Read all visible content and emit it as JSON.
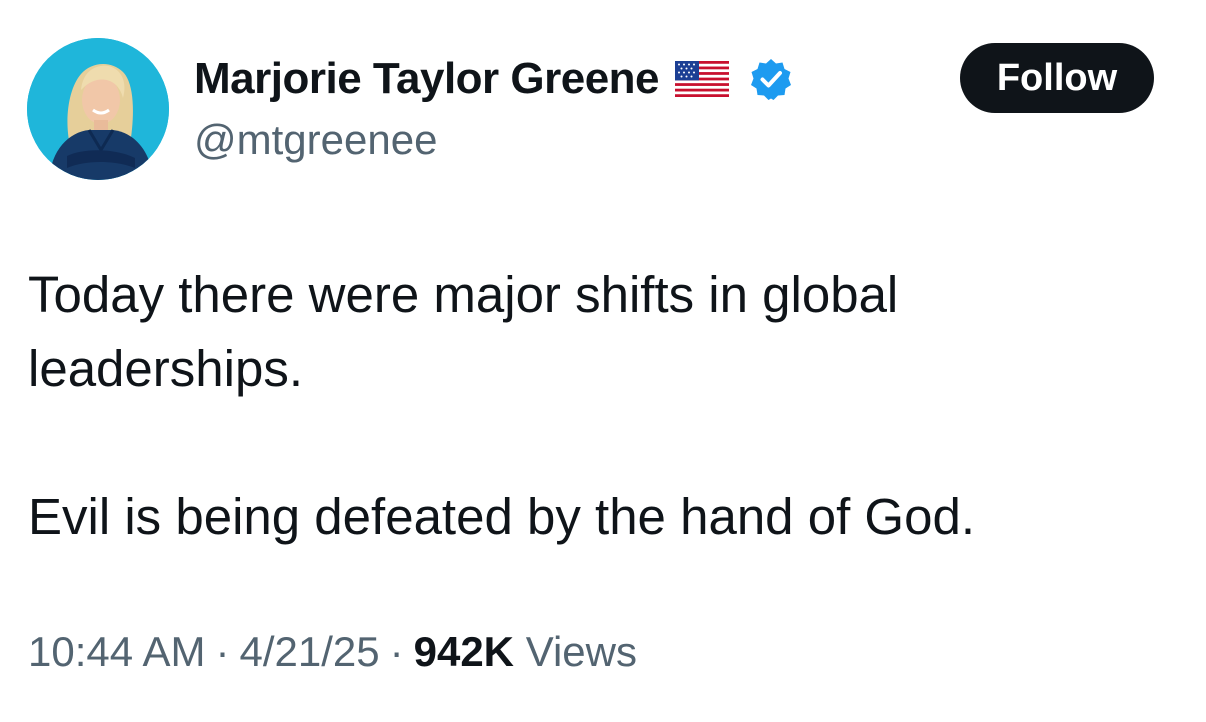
{
  "author": {
    "display_name": "Marjorie Taylor Greene",
    "handle": "@mtgreenee",
    "flag_icon": "us-flag-icon",
    "verified_icon": "verified-badge-icon",
    "verified_color": "#1d9bf0"
  },
  "actions": {
    "follow_label": "Follow"
  },
  "tweet": {
    "paragraphs": [
      "Today there were major shifts in global leaderships.",
      "Evil is being defeated by the hand of God."
    ]
  },
  "meta": {
    "time": "10:44 AM",
    "separator": "·",
    "date": "4/21/25",
    "views_count": "942K",
    "views_label": "Views"
  }
}
